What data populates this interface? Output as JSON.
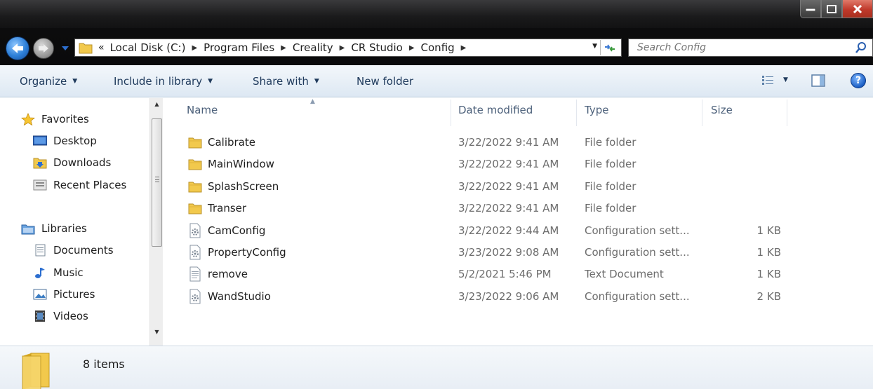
{
  "window": {
    "title_bar_controls": [
      "minimize-icon",
      "maximize-icon",
      "close-icon"
    ]
  },
  "address_bar": {
    "overflow": "«",
    "crumbs": [
      "Local Disk (C:)",
      "Program Files",
      "Creality",
      "CR Studio",
      "Config"
    ],
    "search_placeholder": "Search Config"
  },
  "toolbar": {
    "organize": "Organize",
    "include_in_library": "Include in library",
    "share_with": "Share with",
    "new_folder": "New folder"
  },
  "nav": {
    "favorites": "Favorites",
    "desktop": "Desktop",
    "downloads": "Downloads",
    "recent_places": "Recent Places",
    "libraries": "Libraries",
    "documents": "Documents",
    "music": "Music",
    "pictures": "Pictures",
    "videos": "Videos"
  },
  "columns": {
    "name": "Name",
    "date_modified": "Date modified",
    "type": "Type",
    "size": "Size"
  },
  "files": [
    {
      "name": "Calibrate",
      "date": "3/22/2022 9:41 AM",
      "type": "File folder",
      "size": "",
      "icon": "folder-icon"
    },
    {
      "name": "MainWindow",
      "date": "3/22/2022 9:41 AM",
      "type": "File folder",
      "size": "",
      "icon": "folder-icon"
    },
    {
      "name": "SplashScreen",
      "date": "3/22/2022 9:41 AM",
      "type": "File folder",
      "size": "",
      "icon": "folder-icon"
    },
    {
      "name": "Transer",
      "date": "3/22/2022 9:41 AM",
      "type": "File folder",
      "size": "",
      "icon": "folder-icon"
    },
    {
      "name": "CamConfig",
      "date": "3/22/2022 9:44 AM",
      "type": "Configuration sett...",
      "size": "1 KB",
      "icon": "config-file-icon"
    },
    {
      "name": "PropertyConfig",
      "date": "3/23/2022 9:08 AM",
      "type": "Configuration sett...",
      "size": "1 KB",
      "icon": "config-file-icon"
    },
    {
      "name": "remove",
      "date": "5/2/2021 5:46 PM",
      "type": "Text Document",
      "size": "1 KB",
      "icon": "text-file-icon"
    },
    {
      "name": "WandStudio",
      "date": "3/23/2022 9:06 AM",
      "type": "Configuration sett...",
      "size": "2 KB",
      "icon": "config-file-icon"
    }
  ],
  "status": {
    "item_count": "8 items"
  },
  "colors": {
    "toolbar_text": "#1e395b",
    "header_text": "#4c607a",
    "folder_yellow": "#f2c94c"
  }
}
